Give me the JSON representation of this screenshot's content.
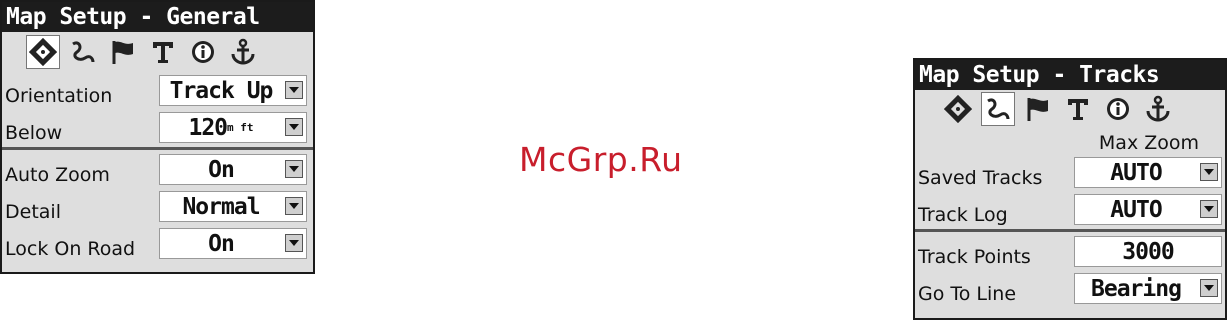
{
  "watermark": "McGrp.Ru",
  "left_screen": {
    "title": "Map Setup - General",
    "tabs": [
      "general-icon",
      "tracks-icon",
      "points-icon",
      "text-icon",
      "info-icon",
      "marine-anchor-icon"
    ],
    "selected_tab": 0,
    "rows": [
      {
        "label": "Orientation",
        "value": "Track Up"
      },
      {
        "label": "Below",
        "value": "120",
        "unit": "m ft"
      },
      {
        "label": "Auto Zoom",
        "value": "On"
      },
      {
        "label": "Detail",
        "value": "Normal"
      },
      {
        "label": "Lock On Road",
        "value": "On"
      }
    ]
  },
  "right_screen": {
    "title": "Map Setup - Tracks",
    "tabs": [
      "general-icon",
      "tracks-icon",
      "points-icon",
      "text-icon",
      "info-icon",
      "marine-anchor-icon"
    ],
    "selected_tab": 1,
    "column_header": "Max Zoom",
    "rows": [
      {
        "label": "Saved Tracks",
        "value": "AUTO"
      },
      {
        "label": "Track Log",
        "value": "AUTO"
      },
      {
        "label": "Track Points",
        "value": "3000"
      },
      {
        "label": "Go To Line",
        "value": "Bearing"
      }
    ]
  }
}
